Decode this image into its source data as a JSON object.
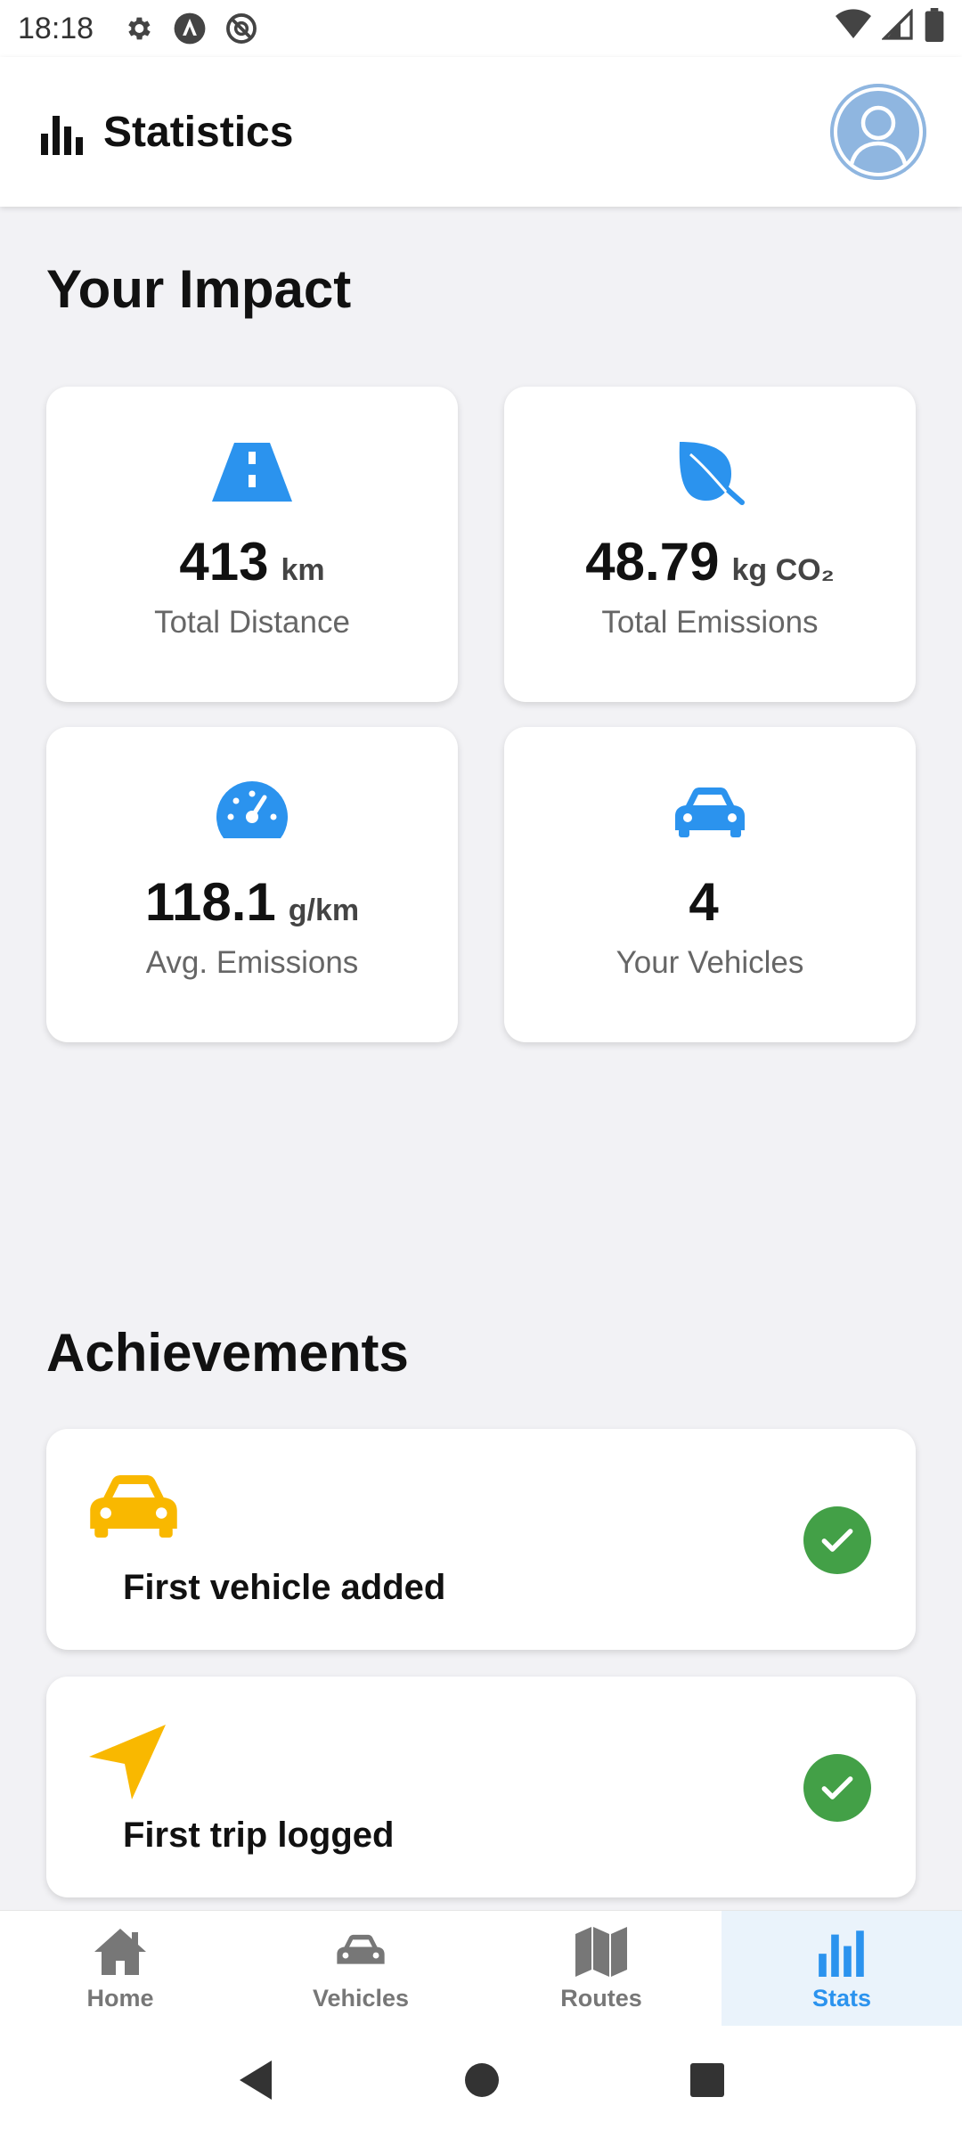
{
  "status_bar": {
    "time": "18:18",
    "icons": [
      "gear-icon",
      "nav-a-icon",
      "blocked-icon",
      "wifi-icon",
      "signal-icon",
      "battery-icon"
    ]
  },
  "app_bar": {
    "title": "Statistics",
    "title_icon": "bar-chart-icon",
    "avatar_icon": "profile-avatar-icon"
  },
  "impact": {
    "title": "Your Impact",
    "cards": [
      {
        "icon": "road-icon",
        "value": "413",
        "unit": "km",
        "label": "Total Distance"
      },
      {
        "icon": "leaf-icon",
        "value": "48.79",
        "unit": "kg CO₂",
        "label": "Total Emissions"
      },
      {
        "icon": "speedometer-icon",
        "value": "118.1",
        "unit": "g/km",
        "label": "Avg. Emissions"
      },
      {
        "icon": "car-icon",
        "value": "4",
        "unit": "",
        "label": "Your Vehicles"
      }
    ]
  },
  "achievements": {
    "title": "Achievements",
    "items": [
      {
        "icon": "car-icon",
        "label": "First vehicle added",
        "completed": true
      },
      {
        "icon": "navigation-arrow-icon",
        "label": "First trip logged",
        "completed": true
      }
    ]
  },
  "bottom_nav": {
    "items": [
      {
        "label": "Home",
        "icon": "home-icon",
        "active": false
      },
      {
        "label": "Vehicles",
        "icon": "car-icon",
        "active": false
      },
      {
        "label": "Routes",
        "icon": "map-icon",
        "active": false
      },
      {
        "label": "Stats",
        "icon": "bar-chart-icon",
        "active": true
      }
    ]
  },
  "system_nav": {
    "items": [
      "back-icon",
      "home-circle-icon",
      "recents-icon"
    ]
  },
  "colors": {
    "accent_blue": "#2b93ee",
    "achievement_yellow": "#f9b800",
    "success_green": "#43a047",
    "background": "#f2f2f5"
  }
}
